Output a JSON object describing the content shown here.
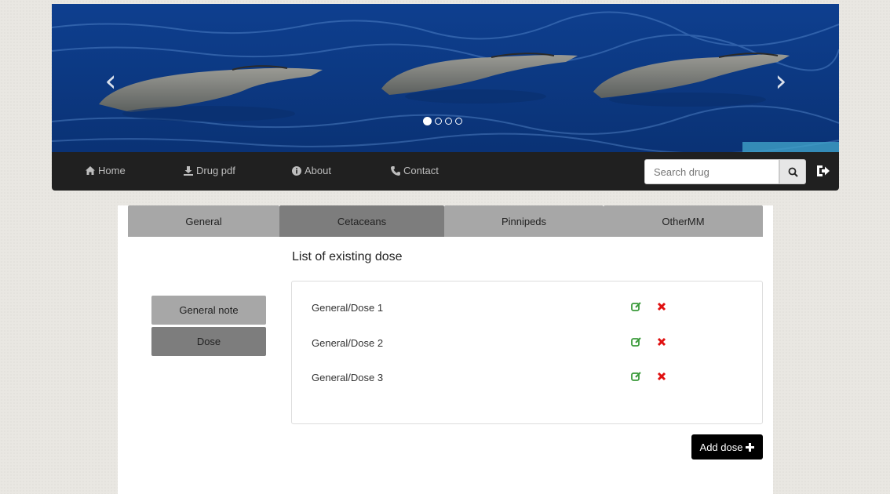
{
  "carousel": {
    "prev_icon": "chevron-left-icon",
    "next_icon": "chevron-right-icon",
    "slide_count": 4,
    "active_slide": 1
  },
  "nav": {
    "items": [
      {
        "label": "Home",
        "icon": "home-icon"
      },
      {
        "label": "Drug pdf",
        "icon": "download-icon"
      },
      {
        "label": "About",
        "icon": "info-icon"
      },
      {
        "label": "Contact",
        "icon": "phone-icon"
      }
    ],
    "search_placeholder": "Search drug",
    "search_icon": "search-icon",
    "logout_icon": "logout-icon"
  },
  "tabs": [
    {
      "label": "General",
      "active": false
    },
    {
      "label": "Cetaceans",
      "active": true
    },
    {
      "label": "Pinnipeds",
      "active": false
    },
    {
      "label": "OtherMM",
      "active": false
    }
  ],
  "side": {
    "general_note": "General note",
    "dose": "Dose"
  },
  "list_title": "List of existing dose",
  "doses": [
    {
      "name": "General/Dose 1"
    },
    {
      "name": "General/Dose 2"
    },
    {
      "name": "General/Dose 3"
    }
  ],
  "add_button": "Add dose",
  "colors": {
    "navbar": "#202020",
    "tab": "#a7a7a7",
    "tab_active": "#7d7d7d",
    "edit": "#3a9a3a",
    "delete": "#e01010"
  }
}
